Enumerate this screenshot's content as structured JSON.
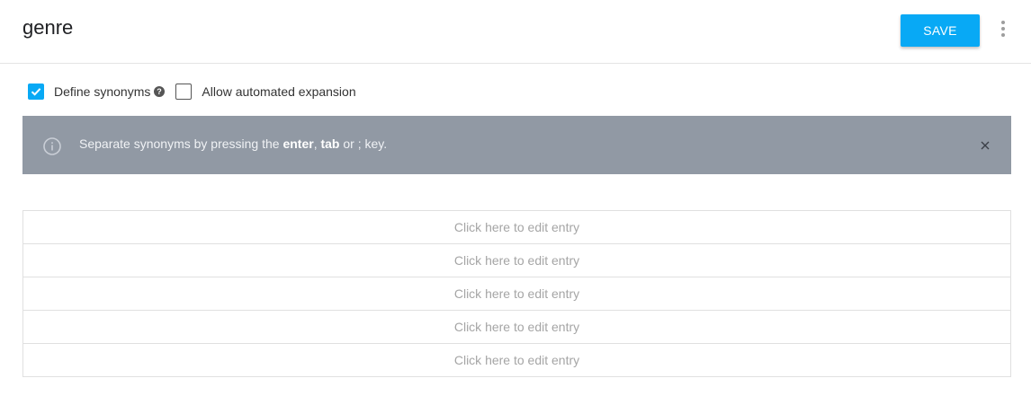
{
  "header": {
    "title": "genre",
    "save_label": "SAVE",
    "more_icon": "more-vert-icon"
  },
  "options": {
    "define_synonyms": {
      "label": "Define synonyms",
      "checked": true,
      "help_icon": "question-circle-icon"
    },
    "automated_expansion": {
      "label": "Allow automated expansion",
      "checked": false
    }
  },
  "banner": {
    "icon": "info-icon",
    "text_before": "Separate synonyms by pressing the ",
    "key1": "enter",
    "sep1": ", ",
    "key2": "tab",
    "text_after": " or ; key.",
    "close_icon": "close-icon"
  },
  "entries": [
    {
      "placeholder": "Click here to edit entry"
    },
    {
      "placeholder": "Click here to edit entry"
    },
    {
      "placeholder": "Click here to edit entry"
    },
    {
      "placeholder": "Click here to edit entry"
    },
    {
      "placeholder": "Click here to edit entry"
    }
  ],
  "colors": {
    "accent": "#08a9f5",
    "banner_bg": "#9199a4"
  }
}
